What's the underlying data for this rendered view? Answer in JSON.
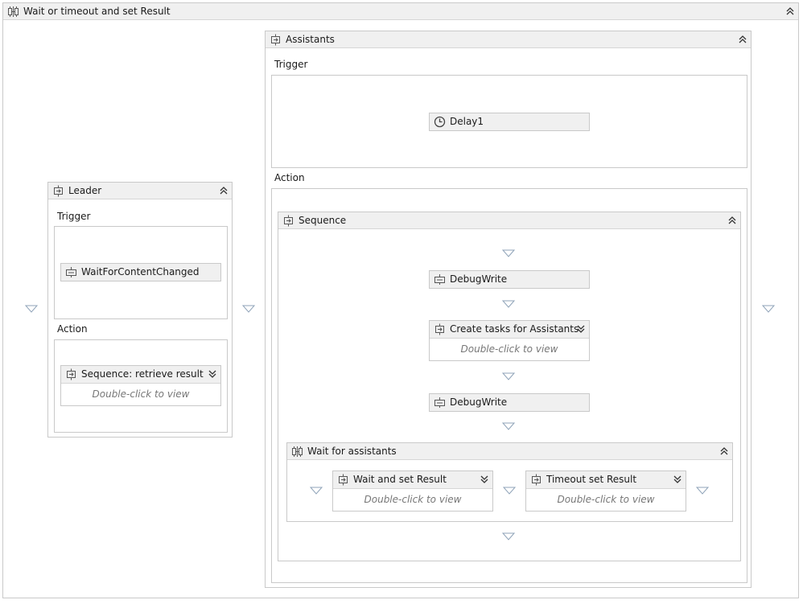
{
  "root": {
    "title": "Wait or timeout and set Result"
  },
  "leader": {
    "title": "Leader",
    "trigger_label": "Trigger",
    "action_label": "Action",
    "trigger_activity": "WaitForContentChanged",
    "action_activity": {
      "title": "Sequence: retrieve result",
      "hint": "Double-click to view"
    }
  },
  "assistants": {
    "title": "Assistants",
    "trigger_label": "Trigger",
    "action_label": "Action",
    "trigger_activity": "Delay1",
    "sequence": {
      "title": "Sequence",
      "items": {
        "debug1": "DebugWrite",
        "create_tasks": {
          "title": "Create tasks for Assistants",
          "hint": "Double-click to view"
        },
        "debug2": "DebugWrite"
      },
      "wait": {
        "title": "Wait for assistants",
        "branches": [
          {
            "title": "Wait and set Result",
            "hint": "Double-click to view"
          },
          {
            "title": "Timeout set Result",
            "hint": "Double-click to view"
          }
        ]
      }
    }
  },
  "icons": {
    "parallel": "parallel-icon",
    "sequence": "sequence-icon",
    "activity": "activity-icon",
    "delay": "clock-icon",
    "collapse": "chevron-double-up-icon",
    "expand": "chevron-double-down-icon",
    "drop": "drop-triangle-icon"
  }
}
